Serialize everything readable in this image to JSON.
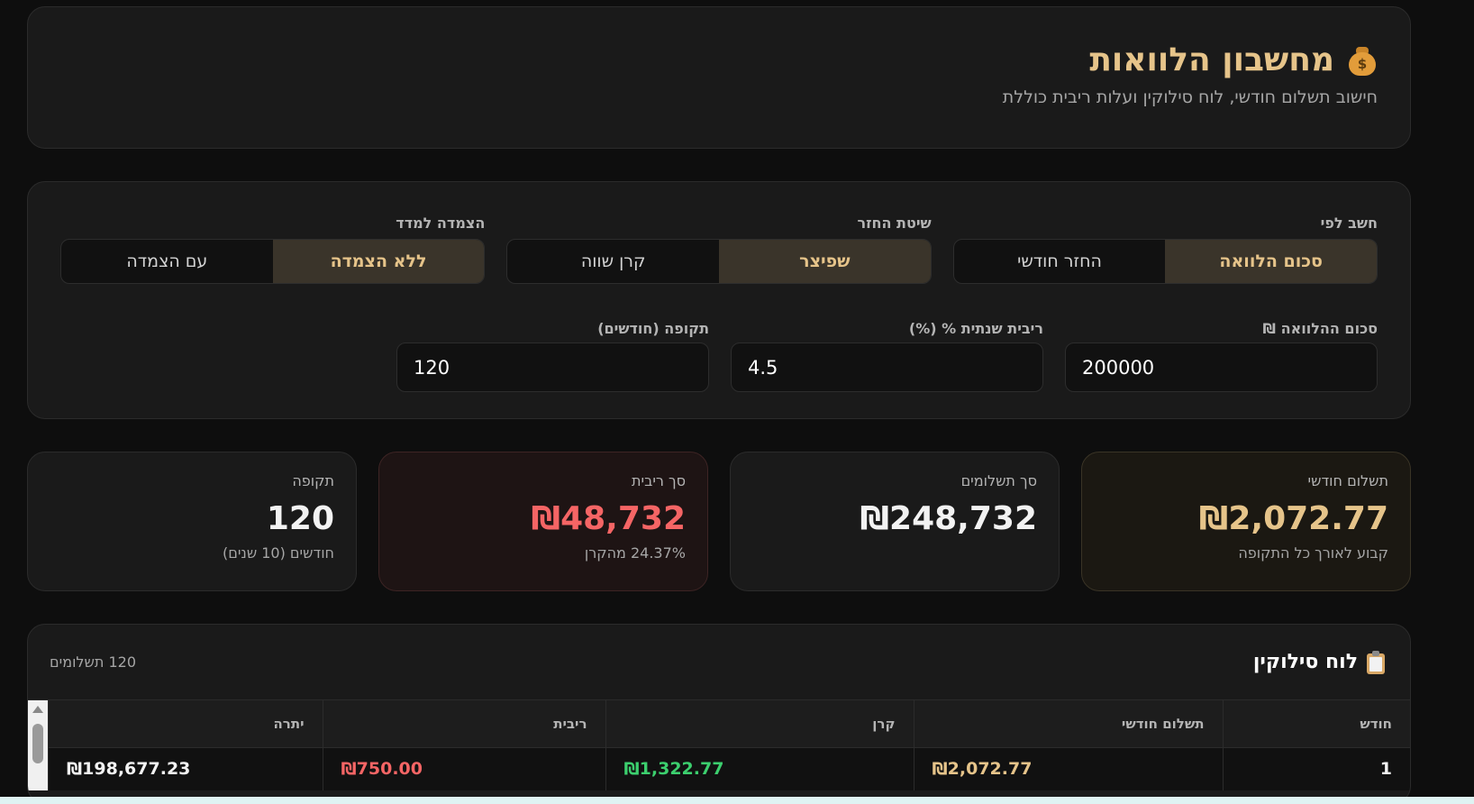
{
  "header": {
    "title": "מחשבון הלוואות",
    "subtitle": "חישוב תשלום חודשי, לוח סילוקין ועלות ריבית כוללת",
    "icon": "money-bag-icon"
  },
  "controls": {
    "calc_by": {
      "label": "חשב לפי",
      "options": [
        "סכום הלוואה",
        "החזר חודשי"
      ],
      "selected": "סכום הלוואה"
    },
    "method": {
      "label": "שיטת החזר",
      "options": [
        "שפיצר",
        "קרן שווה"
      ],
      "selected": "שפיצר"
    },
    "indexation": {
      "label": "הצמדה למדד",
      "options": [
        "ללא הצמדה",
        "עם הצמדה"
      ],
      "selected": "ללא הצמדה"
    },
    "fields": {
      "amount": {
        "label": "סכום ההלוואה ₪",
        "value": "200000"
      },
      "rate": {
        "label": "ריבית שנתית % (%)",
        "value": "4.5"
      },
      "term": {
        "label": "תקופה (חודשים)",
        "value": "120"
      }
    }
  },
  "stats": {
    "monthly": {
      "label": "תשלום חודשי",
      "value": "₪2,072.77",
      "sub": "קבוע לאורך כל התקופה"
    },
    "total": {
      "label": "סך תשלומים",
      "value": "₪248,732",
      "sub": ""
    },
    "interest": {
      "label": "סך ריבית",
      "value": "₪48,732",
      "sub": "24.37% מהקרן"
    },
    "period": {
      "label": "תקופה",
      "value": "120",
      "sub": "חודשים (10 שנים)"
    }
  },
  "schedule": {
    "title": "לוח סילוקין",
    "icon": "clipboard-icon",
    "count": "120 תשלומים",
    "columns": [
      "חודש",
      "תשלום חודשי",
      "קרן",
      "ריבית",
      "יתרה"
    ],
    "rows": [
      {
        "month": "1",
        "payment": "₪2,072.77",
        "principal": "₪1,322.77",
        "interest": "₪750.00",
        "balance": "₪198,677.23"
      }
    ]
  },
  "colors": {
    "accent": "#e6c48a",
    "danger": "#f56565",
    "success": "#3ccf6e",
    "background": "#0e0e0e",
    "card": "#1a1a1a"
  }
}
